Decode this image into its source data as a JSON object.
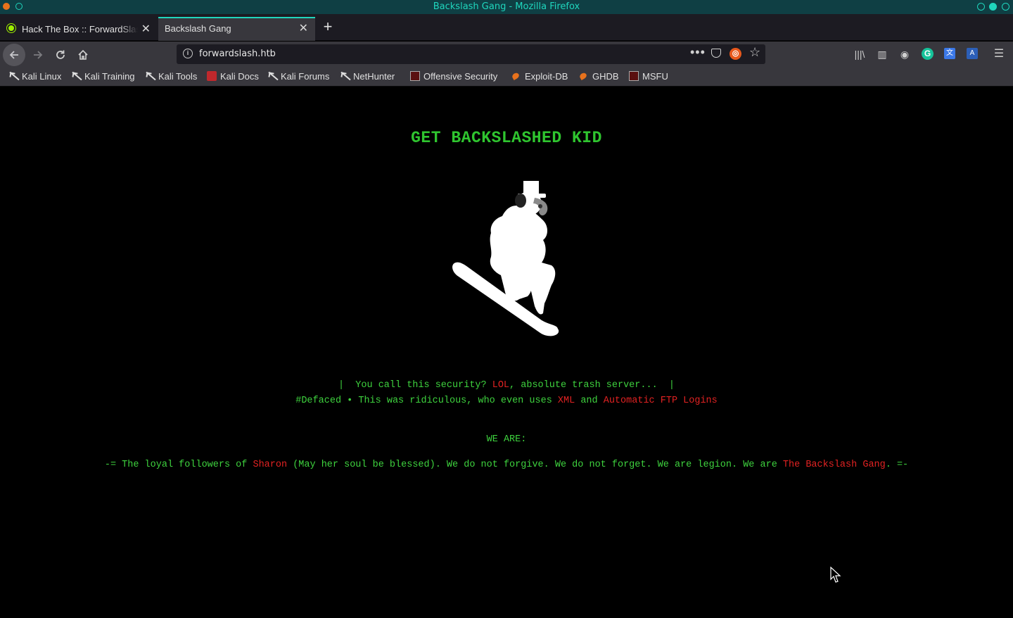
{
  "window": {
    "title": "Backslash Gang - Mozilla Firefox"
  },
  "tabs": [
    {
      "label": "Hack The Box :: ForwardSlash",
      "active": false
    },
    {
      "label": "Backslash Gang",
      "active": true
    }
  ],
  "urlbar": {
    "url": "forwardslash.htb"
  },
  "bookmarks": [
    {
      "label": "Kali Linux",
      "icon": "kali-dragon-icon"
    },
    {
      "label": "Kali Training",
      "icon": "kali-dragon-icon"
    },
    {
      "label": "Kali Tools",
      "icon": "kali-dragon-icon"
    },
    {
      "label": "Kali Docs",
      "icon": "kali-docs-icon"
    },
    {
      "label": "Kali Forums",
      "icon": "kali-dragon-icon"
    },
    {
      "label": "NetHunter",
      "icon": "kali-dragon-icon"
    },
    {
      "label": "Offensive Security",
      "icon": "offsec-icon"
    },
    {
      "label": "Exploit-DB",
      "icon": "exploit-db-icon"
    },
    {
      "label": "GHDB",
      "icon": "exploit-db-icon"
    },
    {
      "label": "MSFU",
      "icon": "offsec-icon"
    }
  ],
  "page": {
    "headline": "GET BACKSLASHED KID",
    "line1": {
      "pre": "|  You call this security? ",
      "red": "LOL",
      "post": ", absolute trash server...  |"
    },
    "line2": {
      "pre": "#Defaced • This was ridiculous, who even uses ",
      "red1": "XML",
      "mid": " and ",
      "red2": "Automatic FTP Logins"
    },
    "we_are": "WE ARE:",
    "line3": {
      "pre": "-= The loyal followers of ",
      "red1": "Sharon",
      "mid": " (May her soul be blessed). We do not forgive. We do not forget. We are legion. We are ",
      "red2": "The Backslash Gang",
      "post": ". =-"
    }
  },
  "colors": {
    "accent": "#1fd6bd",
    "text_green": "#3ed23e",
    "text_red": "#e22222",
    "background": "#000000"
  }
}
